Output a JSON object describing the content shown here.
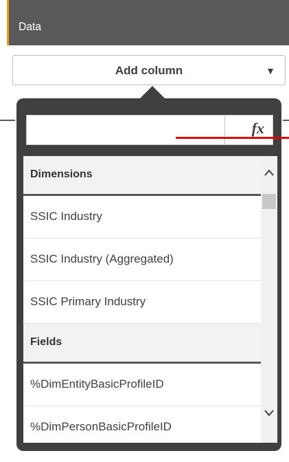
{
  "header": {
    "title": "Data"
  },
  "add_column": {
    "label": "Add column",
    "caret": "▼"
  },
  "search": {
    "value": "",
    "placeholder": "",
    "fx_label": "fx"
  },
  "groups": [
    {
      "title": "Dimensions",
      "items": [
        "SSIC Industry",
        "SSIC Industry (Aggregated)",
        "SSIC Primary Industry"
      ]
    },
    {
      "title": "Fields",
      "items": [
        "%DimEntityBasicProfileID",
        "%DimPersonBasicProfileID"
      ]
    }
  ],
  "colors": {
    "header_bg": "#595959",
    "header_accent": "#e8a317",
    "popover_bg": "#404040",
    "annotation_red": "#e60000"
  },
  "icons": {
    "dropdown": "caret-down-icon",
    "formula": "fx-icon",
    "scroll_up": "chevron-up-icon",
    "scroll_down": "chevron-down-icon"
  }
}
